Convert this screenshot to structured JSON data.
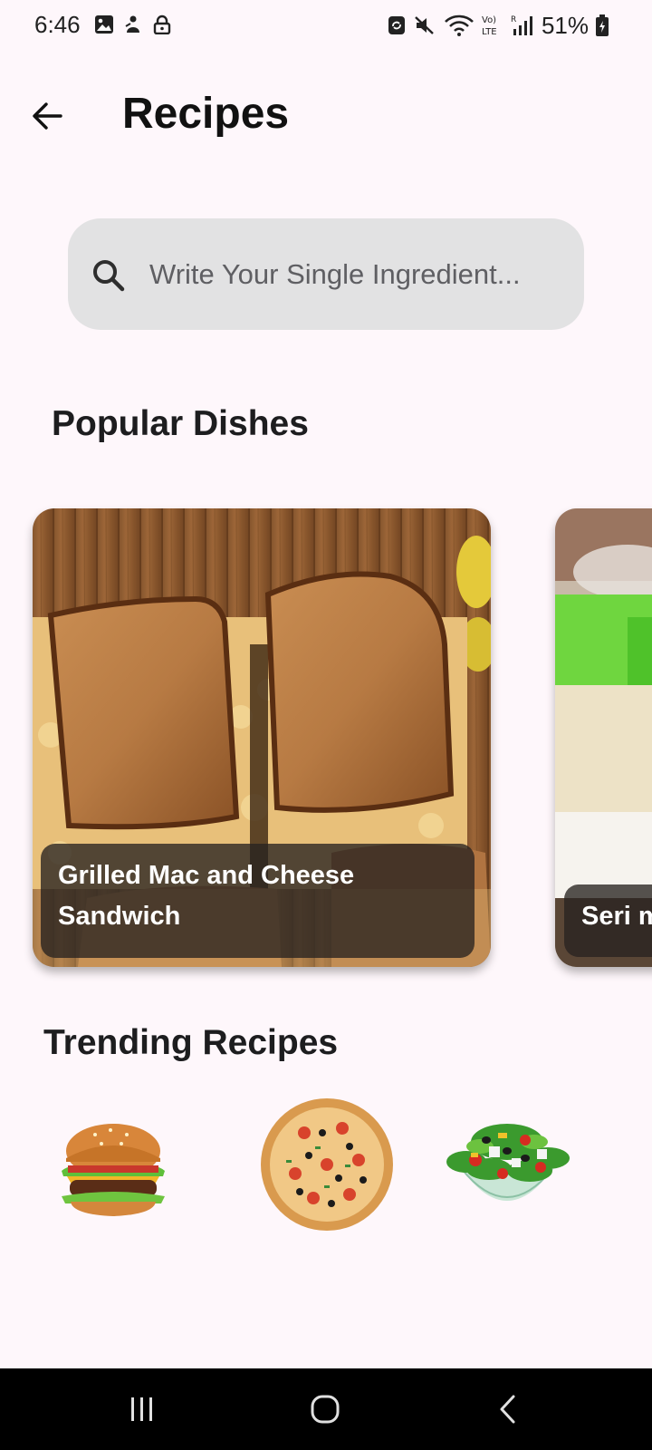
{
  "status_bar": {
    "time": "6:46",
    "battery": "51%",
    "left_icons": [
      "image-icon",
      "notification-figure-icon",
      "lock-icon"
    ],
    "right_icons": [
      "sync-badge-icon",
      "mute-icon",
      "wifi-icon",
      "volte-icon",
      "signal-icon",
      "battery-icon"
    ]
  },
  "app_bar": {
    "title": "Recipes",
    "back_icon": "arrow-left-icon"
  },
  "search": {
    "placeholder": "Write Your Single Ingredient...",
    "icon": "search-icon"
  },
  "popular": {
    "title": "Popular Dishes",
    "dishes": [
      {
        "name": "Grilled Mac and Cheese Sandwich"
      },
      {
        "name": "Seri m"
      }
    ]
  },
  "trending": {
    "title": "Trending Recipes",
    "items": [
      {
        "name": "burger-image"
      },
      {
        "name": "pizza-image"
      },
      {
        "name": "salad-image"
      }
    ]
  },
  "nav": {
    "icons": [
      "recent-apps-icon",
      "home-icon",
      "back-icon"
    ]
  },
  "colors": {
    "background": "#fef7fb",
    "search_bg": "#e2e2e3",
    "caption_bg": "#282320",
    "nav_bg": "#000000"
  }
}
